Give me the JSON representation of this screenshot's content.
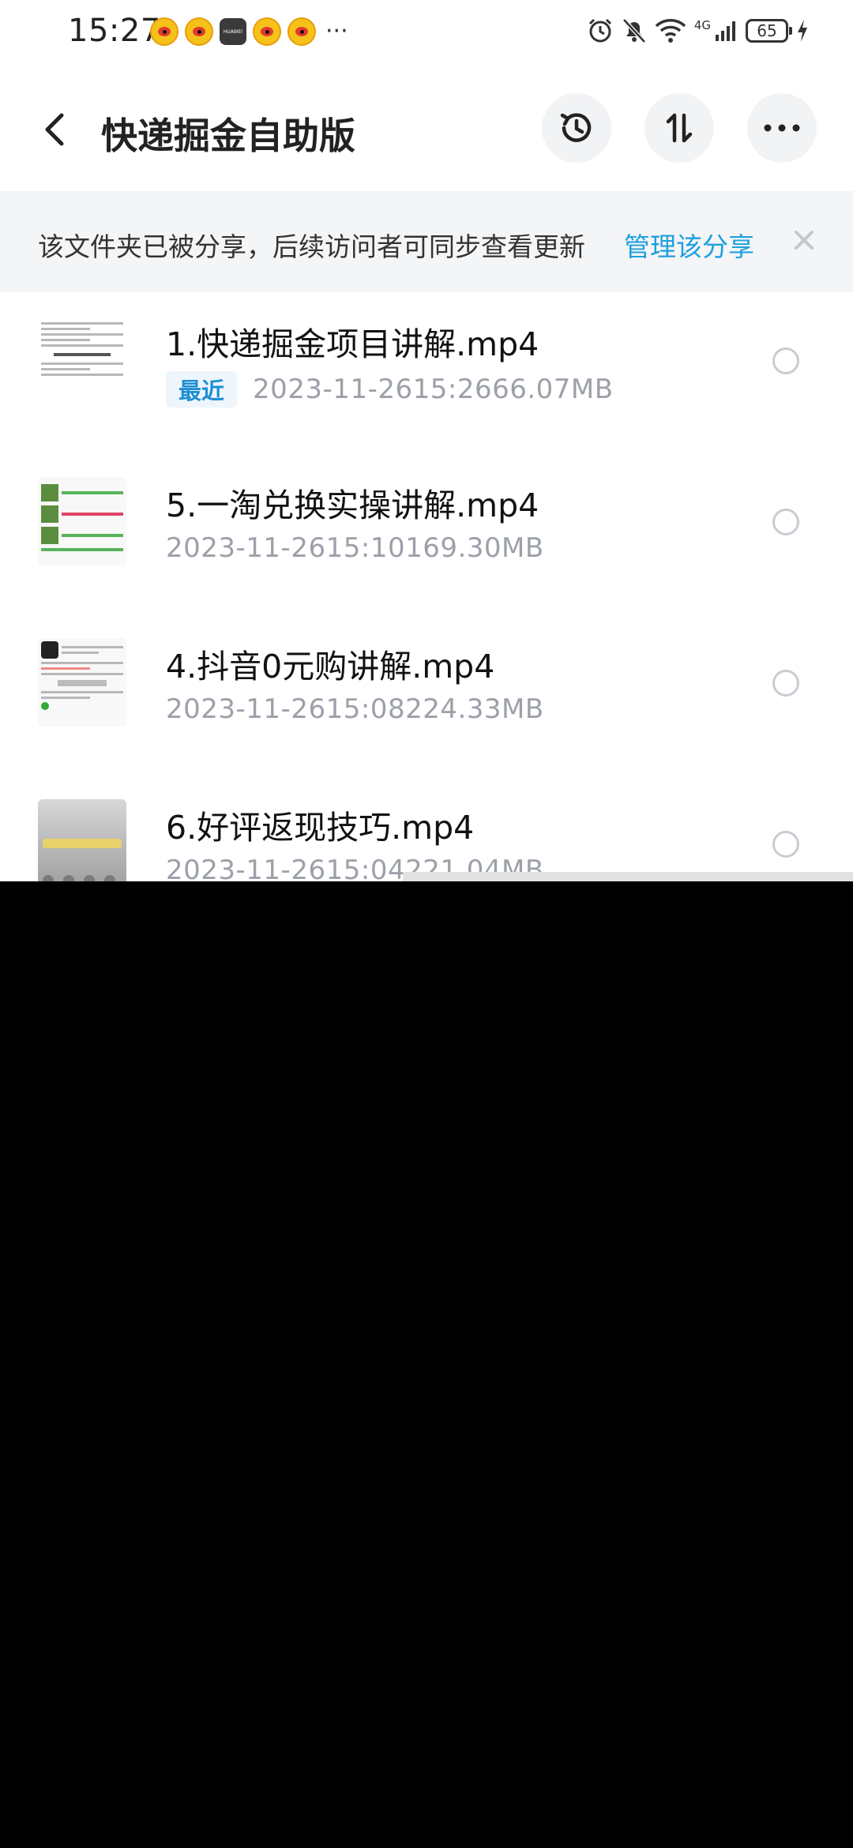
{
  "status_bar": {
    "time": "15:27",
    "battery": "65",
    "network": "4G",
    "more": "···",
    "huawei_label": "HUAWEI"
  },
  "header": {
    "title": "快递掘金自助版"
  },
  "share_banner": {
    "message": "该文件夹已被分享，后续访问者可同步查看更新",
    "manage_link": "管理该分享"
  },
  "files": [
    {
      "name": "1.快递掘金项目讲解.mp4",
      "badge": "最近",
      "date": "2023-11-26",
      "time": "15:26",
      "size": "66.07MB"
    },
    {
      "name": "5.一淘兑换实操讲解.mp4",
      "date": "2023-11-26",
      "time": "15:10",
      "size": "169.30MB"
    },
    {
      "name": "4.抖音0元购讲解.mp4",
      "date": "2023-11-26",
      "time": "15:08",
      "size": "224.33MB"
    },
    {
      "name": "6.好评返现技巧.mp4",
      "date": "2023-11-26",
      "time": "15:04",
      "size": "221.04MB"
    }
  ],
  "colors": {
    "accent": "#1fa0de",
    "badge_bg": "#eef5fb",
    "meta_gray": "#9ca0a8"
  }
}
